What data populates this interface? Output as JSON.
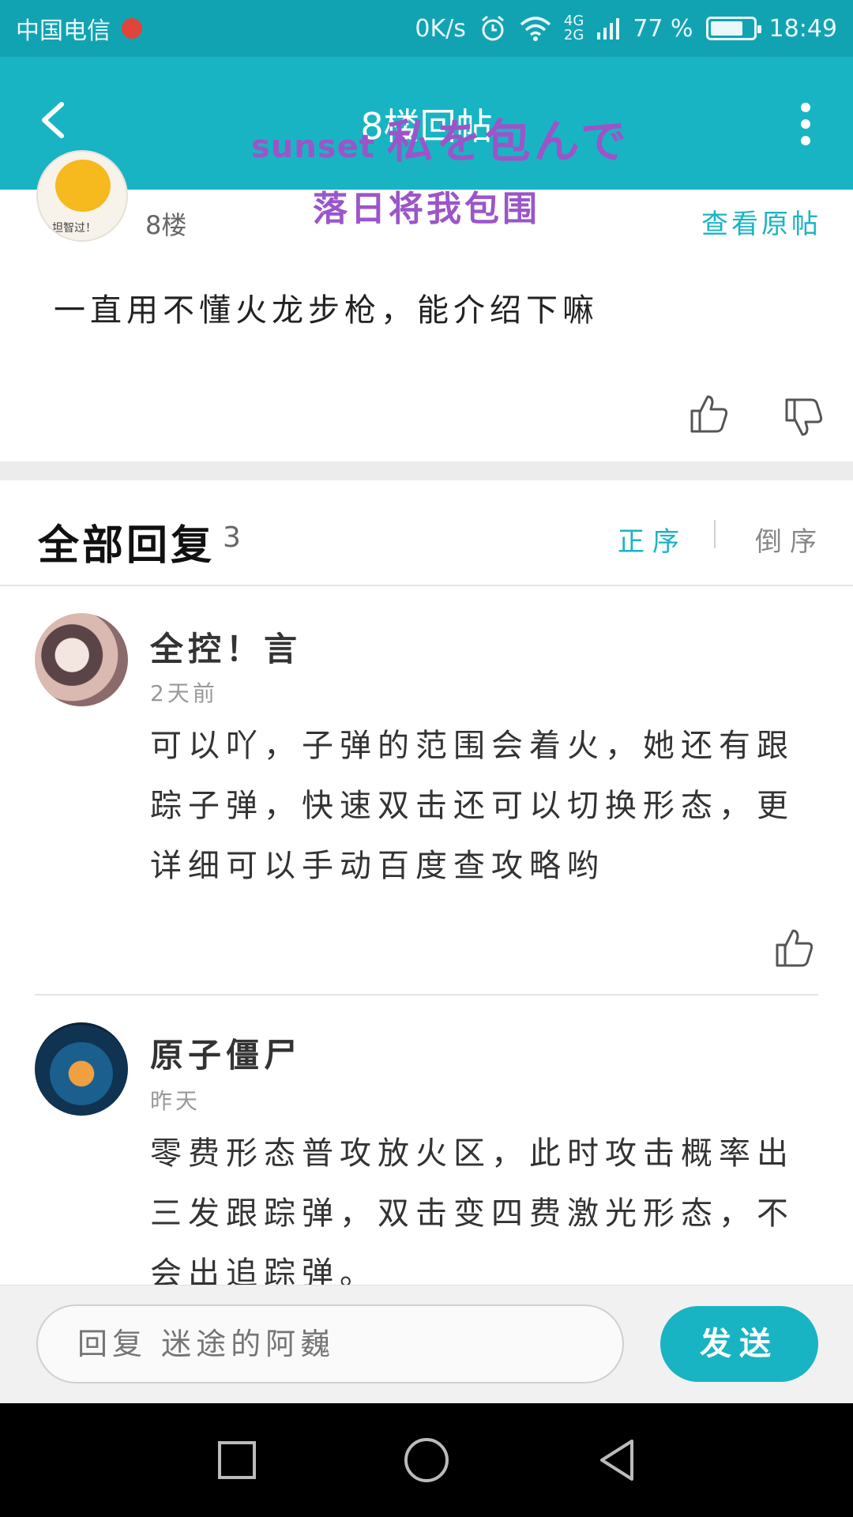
{
  "status_bar": {
    "carrier": "中国电信",
    "speed": "0K/s",
    "net_top": "4G",
    "net_bottom": "2G",
    "battery": "77 %",
    "battery_level": 0.77,
    "time": "18:49"
  },
  "app_bar": {
    "title": "8楼回帖",
    "overlay_small": "sunset",
    "overlay_big": "私を包んで",
    "overlay_line2": "落日将我包围"
  },
  "post": {
    "avatar_caption": "坦智过！",
    "floor": "8楼",
    "view_original": "查看原帖",
    "content": "一直用不懂火龙步枪，能介绍下嘛"
  },
  "replies_header": {
    "title": "全部回复",
    "count": "3",
    "sort_asc": "正序",
    "sort_desc": "倒序"
  },
  "replies": [
    {
      "name": "全控！言",
      "time": "2天前",
      "text": "可以吖，子弹的范围会着火，她还有跟踪子弹，快速双击还可以切换形态，更详细可以手动百度查攻略哟"
    },
    {
      "name": "原子僵尸",
      "time": "昨天",
      "text": "零费形态普攻放火区，此时攻击概率出三发跟踪弹，双击变四费激光形态，不会出追踪弹。"
    }
  ],
  "input_bar": {
    "placeholder": "回复 迷途的阿巍",
    "send_label": "发送"
  },
  "colors": {
    "accent": "#19b4c3",
    "status_bar": "#12a3b3",
    "overlay_text": "#9b55c9"
  },
  "icons": [
    "back-arrow-icon",
    "more-vertical-icon",
    "thumb-up-icon",
    "thumb-down-icon",
    "alarm-icon",
    "wifi-icon",
    "battery-icon",
    "nav-recent-icon",
    "nav-home-icon",
    "nav-back-icon"
  ]
}
